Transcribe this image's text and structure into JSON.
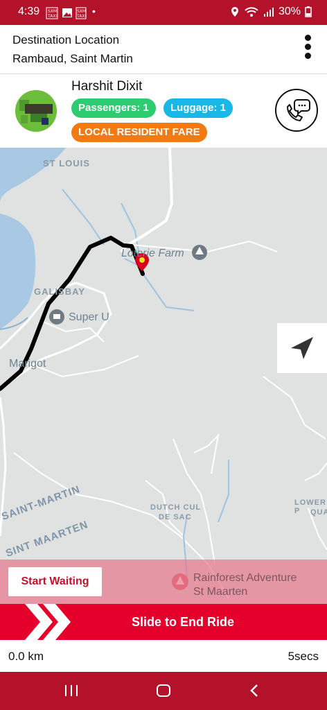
{
  "status_bar": {
    "time": "4:39",
    "notif_1": "SXM\nTAXI",
    "notif_2": "SXM\nTAXI",
    "battery": "30%"
  },
  "destination": {
    "label": "Destination Location",
    "address": "Rambaud, Saint Martin"
  },
  "rider": {
    "name": "Harshit Dixit",
    "passengers": "Passengers: 1",
    "luggage": "Luggage: 1",
    "fare_badge": "LOCAL RESIDENT FARE"
  },
  "map": {
    "labels": {
      "st_louis": "ST LOUIS",
      "loterie_farm": "Loterie Farm",
      "galisbay": "GALISBAY",
      "super_u": "Super U",
      "marigot": "Marigot",
      "dutch_cul_1": "DUTCH CUL",
      "dutch_cul_2": "DE SAC",
      "saint_martin": "SAINT-MARTIN",
      "sint_maarten": "SINT MAARTEN",
      "lower_1": "LOWER P",
      "lower_2": "QUA",
      "rainforest_1": "Rainforest Adventure",
      "rainforest_2": "St Maarten"
    },
    "colors": {
      "land": "#dfe2e0",
      "water": "#a8c8e4",
      "route": "#000000",
      "pin": "#d9001b"
    }
  },
  "actions": {
    "start_waiting": "Start Waiting",
    "slide_end_ride": "Slide to End Ride"
  },
  "trip": {
    "distance": "0.0 km",
    "duration": "5secs"
  },
  "colors": {
    "brand": "#b3122a",
    "slide": "#e4002b"
  }
}
